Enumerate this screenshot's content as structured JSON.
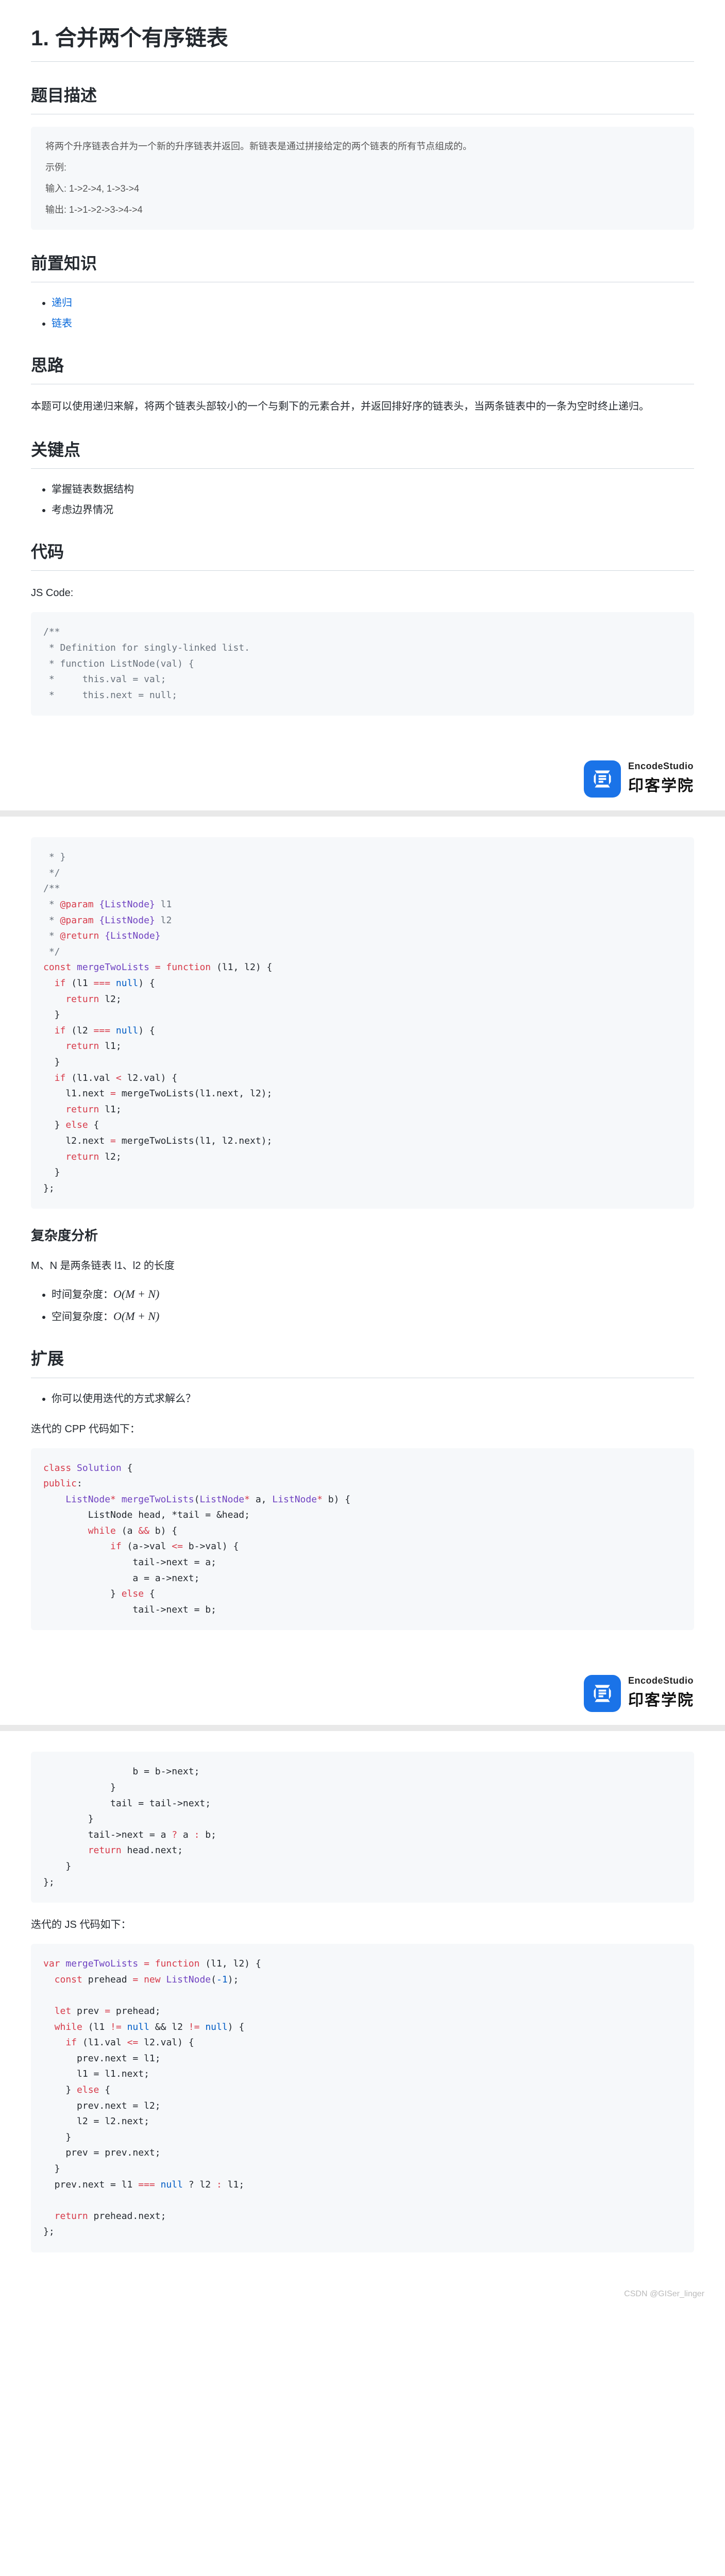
{
  "title": "1. 合并两个有序链表",
  "h2_desc": "题目描述",
  "desc": {
    "line1": "将两个升序链表合并为一个新的升序链表并返回。新链表是通过拼接给定的两个链表的所有节点组成的。",
    "line2": "示例:",
    "line3": "输入: 1->2->4, 1->3->4",
    "line4": "输出: 1->1->2->3->4->4"
  },
  "h2_prereq": "前置知识",
  "prereq": {
    "a": "递归",
    "b": "链表"
  },
  "h2_idea": "思路",
  "idea_text": "本题可以使用递归来解，将两个链表头部较小的一个与剩下的元素合并，并返回排好序的链表头，当两条链表中的一条为空时终止递归。",
  "h2_key": "关键点",
  "key": {
    "a": "掌握链表数据结构",
    "b": "考虑边界情况"
  },
  "h2_code": "代码",
  "js_code_label": "JS Code:",
  "code1": {
    "l1": "/**",
    "l2": " * Definition for singly-linked list.",
    "l3": " * function ListNode(val) {",
    "l4": " *     this.val = val;",
    "l5": " *     this.next = null;"
  },
  "wm": {
    "en": "EncodeStudio",
    "cn": "印客学院"
  },
  "code2": {
    "l1": " * }",
    "l2": " */",
    "l3": "/**",
    "l4a": " * ",
    "l4b": "@param",
    "l4c": " {ListNode}",
    "l4d": " l1",
    "l5a": " * ",
    "l5b": "@param",
    "l5c": " {ListNode}",
    "l5d": " l2",
    "l6a": " * ",
    "l6b": "@return",
    "l6c": " {ListNode}",
    "l7": " */",
    "l8a": "const",
    "l8b": " mergeTwoLists ",
    "l8c": "=",
    "l8d": " function",
    "l8e": " (l1, l2) {",
    "l9a": "  if",
    "l9b": " (l1 ",
    "l9c": "===",
    "l9d": " null",
    "l9e": ") {",
    "l10a": "    return",
    "l10b": " l2;",
    "l11": "  }",
    "l12a": "  if",
    "l12b": " (l2 ",
    "l12c": "===",
    "l12d": " null",
    "l12e": ") {",
    "l13a": "    return",
    "l13b": " l1;",
    "l14": "  }",
    "l15a": "  if",
    "l15b": " (l1.val ",
    "l15c": "<",
    "l15d": " l2.val) {",
    "l16a": "    l1.next ",
    "l16b": "=",
    "l16c": " mergeTwoLists(l1.next, l2);",
    "l17a": "    return",
    "l17b": " l1;",
    "l18a": "  } ",
    "l18b": "else",
    "l18c": " {",
    "l19a": "    l2.next ",
    "l19b": "=",
    "l19c": " mergeTwoLists(l1, l2.next);",
    "l20a": "    return",
    "l20b": " l2;",
    "l21": "  }",
    "l22": "};"
  },
  "h3_complexity": "复杂度分析",
  "complexity_intro": "M、N 是两条链表 l1、l2 的长度",
  "complexity": {
    "time_label": "时间复杂度：",
    "time_val": "O(M + N)",
    "space_label": "空间复杂度：",
    "space_val": "O(M + N)"
  },
  "h2_ext": "扩展",
  "ext_q": "你可以使用迭代的方式求解么？",
  "ext_cpp_label": "迭代的 CPP 代码如下：",
  "code3": {
    "l1a": "class",
    "l1b": " Solution",
    "l1c": " {",
    "l2a": "public",
    "l2b": ":",
    "l3a": "    ListNode",
    "l3b": "*",
    "l3c": " mergeTwoLists",
    "l3d": "(",
    "l3e": "ListNode",
    "l3f": "*",
    "l3g": " a, ",
    "l3h": "ListNode",
    "l3i": "*",
    "l3j": " b) {",
    "l4": "        ListNode head, *tail = &head;",
    "l5a": "        while",
    "l5b": " (a ",
    "l5c": "&&",
    "l5d": " b) {",
    "l6a": "            if",
    "l6b": " (a->val ",
    "l6c": "<=",
    "l6d": " b->val) {",
    "l7": "                tail->next = a;",
    "l8": "                a = a->next;",
    "l9a": "            } ",
    "l9b": "else",
    "l9c": " {",
    "l10": "                tail->next = b;"
  },
  "code4": {
    "l1": "                b = b->next;",
    "l2": "            }",
    "l3": "            tail = tail->next;",
    "l4": "        }",
    "l5a": "        tail->next = a ",
    "l5b": "?",
    "l5c": " a ",
    "l5d": ":",
    "l5e": " b;",
    "l6a": "        return",
    "l6b": " head.next;",
    "l7": "    }",
    "l8": "};"
  },
  "ext_js_label": "迭代的 JS 代码如下：",
  "code5": {
    "l1a": "var",
    "l1b": " mergeTwoLists ",
    "l1c": "=",
    "l1d": " function",
    "l1e": " (l1, l2) {",
    "l2a": "  const",
    "l2b": " prehead ",
    "l2c": "=",
    "l2d": " new",
    "l2e": " ListNode",
    "l2f": "(",
    "l2g": "-1",
    "l2h": ");",
    "l3": "",
    "l4a": "  let",
    "l4b": " prev ",
    "l4c": "=",
    "l4d": " prehead;",
    "l5a": "  while",
    "l5b": " (l1 ",
    "l5c": "!=",
    "l5d": " null",
    "l5e": " && ",
    "l5f": "l2 ",
    "l5g": "!=",
    "l5h": " null",
    "l5i": ") {",
    "l6a": "    if",
    "l6b": " (l1.val ",
    "l6c": "<=",
    "l6d": " l2.val) {",
    "l7": "      prev.next = l1;",
    "l8": "      l1 = l1.next;",
    "l9a": "    } ",
    "l9b": "else",
    "l9c": " {",
    "l10": "      prev.next = l2;",
    "l11": "      l2 = l2.next;",
    "l12": "    }",
    "l13": "    prev = prev.next;",
    "l14": "  }",
    "l15a": "  prev.next = l1 ",
    "l15b": "===",
    "l15c": " null",
    "l15d": " ? ",
    "l15e": "l2 ",
    "l15f": ":",
    "l15g": " l1;",
    "l16": "",
    "l17a": "  return",
    "l17b": " prehead.next;",
    "l18": "};"
  },
  "footer_wm": "CSDN @GISer_linger"
}
